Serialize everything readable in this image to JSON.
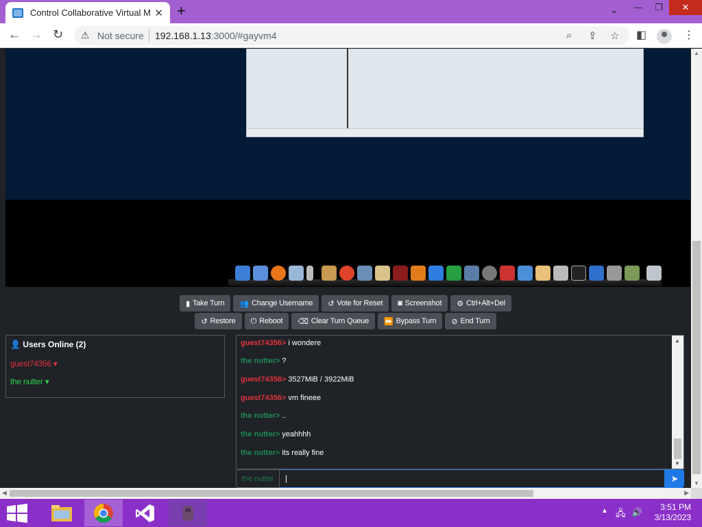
{
  "browser": {
    "tab_title": "Control Collaborative Virtual Mac",
    "new_tab": "+",
    "security_label": "Not secure",
    "url_host": "192.168.1.13",
    "url_rest": ":3000/#gayvm4"
  },
  "vm_buttons_row1": [
    {
      "icon": "user-icon",
      "label": "Take Turn"
    },
    {
      "icon": "users-icon",
      "label": "Change Username"
    },
    {
      "icon": "undo-icon",
      "label": "Vote for Reset"
    },
    {
      "icon": "camera-icon",
      "label": "Screenshot"
    },
    {
      "icon": "gear-icon",
      "label": "Ctrl+Alt+Del"
    }
  ],
  "vm_buttons_row2": [
    {
      "icon": "restore-icon",
      "label": "Restore"
    },
    {
      "icon": "power-icon",
      "label": "Reboot"
    },
    {
      "icon": "eraser-icon",
      "label": "Clear Turn Queue"
    },
    {
      "icon": "fast-forward-icon",
      "label": "Bypass Turn"
    },
    {
      "icon": "ban-icon",
      "label": "End Turn"
    }
  ],
  "users": {
    "heading": "Users Online (2)",
    "list": [
      {
        "name": "guest74356",
        "color": "#e0323c"
      },
      {
        "name": "the nutter",
        "color": "#2fd14a"
      }
    ]
  },
  "chat": {
    "messages": [
      {
        "user": "guest74356>",
        "text": "i wondere",
        "color": "#e0323c"
      },
      {
        "user": "the nutter>",
        "text": "?",
        "color": "#1f8a57"
      },
      {
        "user": "guest74356>",
        "text": "3527MiB / 3922MiB",
        "color": "#e0323c"
      },
      {
        "user": "guest74356>",
        "text": "vm fineee",
        "color": "#e0323c"
      },
      {
        "user": "the nutter>",
        "text": "..",
        "color": "#1f8a57"
      },
      {
        "user": "the nutter>",
        "text": "yeahhhh",
        "color": "#1f8a57"
      },
      {
        "user": "the nutter>",
        "text": "its really fine",
        "color": "#1f8a57"
      }
    ],
    "input_label": "the nutter",
    "input_value": "|"
  },
  "taskbar": {
    "time": "3:51 PM",
    "date": "3/13/2023"
  }
}
